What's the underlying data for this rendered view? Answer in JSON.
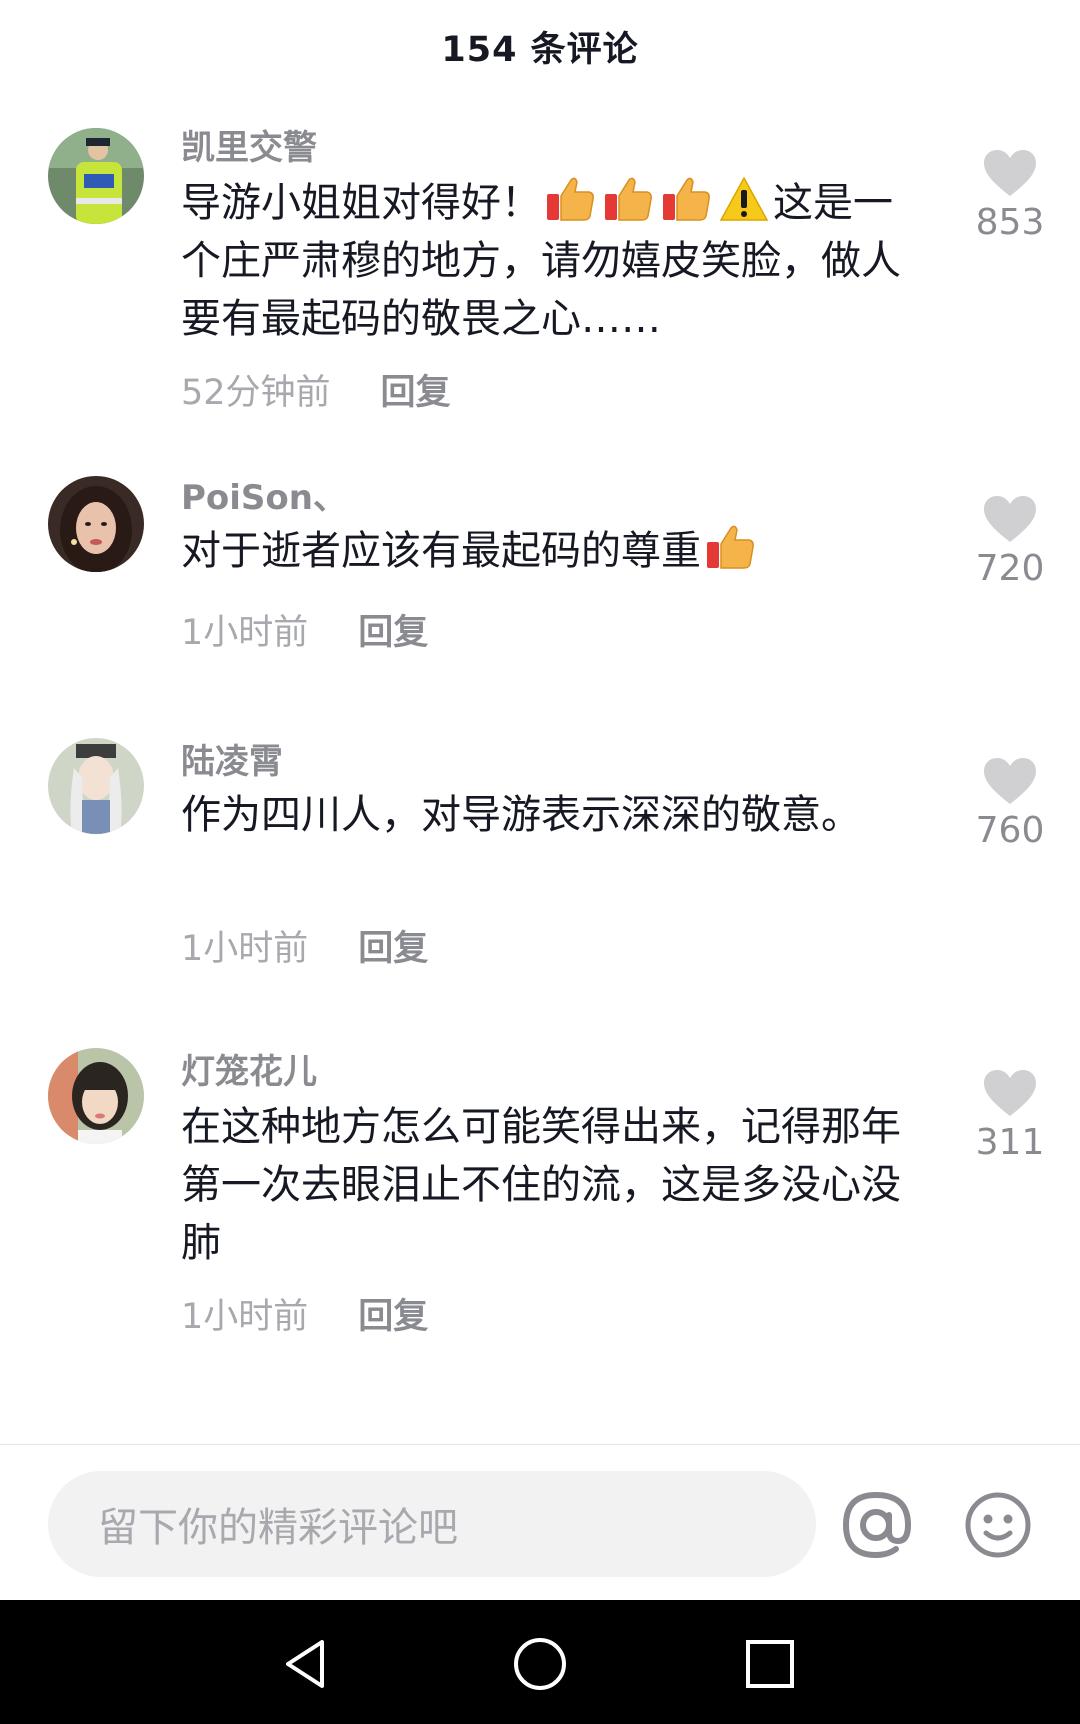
{
  "header": {
    "title": "154 条评论"
  },
  "comments": [
    {
      "username": "凯里交警",
      "text_before_emoji": "导游小姐姐对得好！",
      "emojis": [
        "thumbs-up-icon",
        "thumbs-up-icon",
        "thumbs-up-icon",
        "warning-icon"
      ],
      "text_after_emoji": "这是一个庄严肃穆的地方，请勿嬉皮笑脸，做人要有最起码的敬畏之心……",
      "time": "52分钟前",
      "reply_label": "回复",
      "likes": "853"
    },
    {
      "username": "PoiSon、",
      "text_before_emoji": "对于逝者应该有最起码的尊重",
      "emojis": [
        "thumbs-up-icon"
      ],
      "text_after_emoji": "",
      "time": "1小时前",
      "reply_label": "回复",
      "likes": "720"
    },
    {
      "username": "陆凌霄",
      "text_before_emoji": "作为四川人，对导游表示深深的敬意。",
      "emojis": [],
      "text_after_emoji": "",
      "time": "1小时前",
      "reply_label": "回复",
      "likes": "760"
    },
    {
      "username": "灯笼花儿",
      "text_before_emoji": "在这种地方怎么可能笑得出来，记得那年第一次去眼泪止不住的流，这是多没心没肺",
      "emojis": [],
      "text_after_emoji": "",
      "time": "1小时前",
      "reply_label": "回复",
      "likes": "311"
    }
  ],
  "input": {
    "placeholder": "留下你的精彩评论吧"
  },
  "icons": {
    "at": "at-icon",
    "emoji": "smiley-icon",
    "like": "heart-icon",
    "nav_back": "back-triangle-icon",
    "nav_home": "home-circle-icon",
    "nav_recents": "recents-square-icon"
  },
  "colors": {
    "primary_text": "#161823",
    "secondary_text": "#8a8b91",
    "heart": "#d0d0d3",
    "nav_bar": "#000000"
  }
}
